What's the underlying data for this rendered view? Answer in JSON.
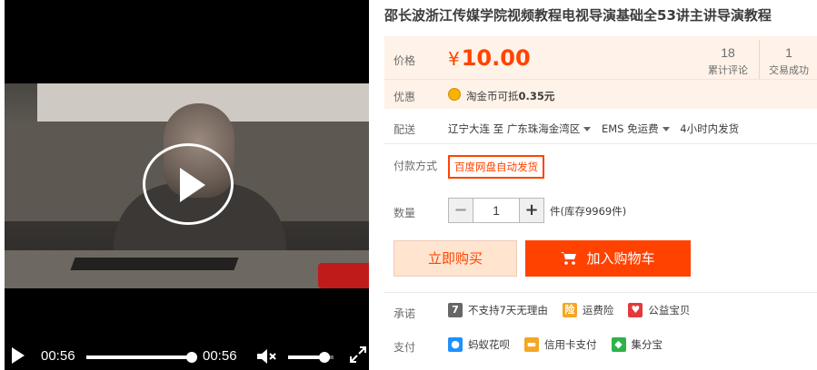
{
  "video": {
    "current_time": "00:56",
    "duration": "00:56",
    "progress": 1.0,
    "volume": 0.8
  },
  "product": {
    "title": "邵长波浙江传媒学院视频教程电视导演基础全53讲主讲导演教程"
  },
  "price": {
    "label": "价格",
    "currency": "¥",
    "value": "10.00",
    "reviews_count": "18",
    "reviews_label": "累计评论",
    "deals_count": "1",
    "deals_label": "交易成功"
  },
  "promo": {
    "label": "优惠",
    "text_prefix": "淘金币可抵",
    "amount": "0.35元"
  },
  "shipping": {
    "label": "配送",
    "from": "辽宁大连",
    "to_word": "至",
    "to": "广东珠海金湾区",
    "method": "EMS 免运费",
    "dispatch": "4小时内发货"
  },
  "payment_method": {
    "label": "付款方式",
    "option": "百度网盘自动发货"
  },
  "quantity": {
    "label": "数量",
    "minus": "−",
    "value": "1",
    "plus": "+",
    "stock": "件(库存9969件)"
  },
  "actions": {
    "buy_now": "立即购买",
    "add_to_cart": "加入购物车"
  },
  "promise": {
    "label": "承诺",
    "items": [
      {
        "icon": "seven-days-icon",
        "text": "不支持7天无理由",
        "color": "#666666"
      },
      {
        "icon": "shipping-insurance-icon",
        "text": "运费险",
        "color": "#f5a623"
      },
      {
        "icon": "charity-icon",
        "text": "公益宝贝",
        "color": "#e4393c"
      }
    ]
  },
  "pay": {
    "label": "支付",
    "items": [
      {
        "icon": "huabei-icon",
        "text": "蚂蚁花呗",
        "color": "#1e90ff"
      },
      {
        "icon": "credit-card-icon",
        "text": "信用卡支付",
        "color": "#f5a623"
      },
      {
        "icon": "jifenbao-icon",
        "text": "集分宝",
        "color": "#2db34a"
      }
    ]
  },
  "colors": {
    "accent": "#ff4400",
    "price_bg": "#fff2e8",
    "cart_button": "#ff4200",
    "buy_button_bg": "#ffe4d0"
  }
}
